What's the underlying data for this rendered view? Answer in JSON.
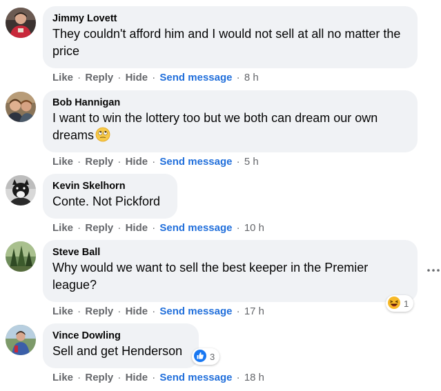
{
  "comments": [
    {
      "author": "Jimmy Lovett",
      "text": "They couldn't afford him and I would not sell at all no matter the price",
      "actions": {
        "like": "Like",
        "reply": "Reply",
        "hide": "Hide",
        "send": "Send message"
      },
      "time": "8 h",
      "avatar_icon": "person-red-shirt"
    },
    {
      "author": "Bob Hannigan",
      "text": "I want to win the lottery too but we both can dream our own dreams",
      "emoji": "face-with-rolling-eyes",
      "actions": {
        "like": "Like",
        "reply": "Reply",
        "hide": "Hide",
        "send": "Send message"
      },
      "time": "5 h",
      "avatar_icon": "two-people-selfie"
    },
    {
      "author": "Kevin Skelhorn",
      "text": "Conte. Not Pickford",
      "actions": {
        "like": "Like",
        "reply": "Reply",
        "hide": "Hide",
        "send": "Send message"
      },
      "time": "10 h",
      "avatar_icon": "black-white-dog"
    },
    {
      "author": "Steve Ball",
      "text": "Why would we want to sell the best keeper in the Premier league?",
      "actions": {
        "like": "Like",
        "reply": "Reply",
        "hide": "Hide",
        "send": "Send message"
      },
      "time": "17 h",
      "avatar_icon": "trees-landscape",
      "reaction": {
        "icon": "haha-reaction",
        "count": "1"
      }
    },
    {
      "author": "Vince Dowling",
      "text": "Sell and get Henderson",
      "actions": {
        "like": "Like",
        "reply": "Reply",
        "hide": "Hide",
        "send": "Send message"
      },
      "time": "18 h",
      "avatar_icon": "person-outdoors",
      "reaction": {
        "icon": "like-reaction",
        "count": "3"
      }
    }
  ],
  "more_options_icon": "ellipsis-icon",
  "colors": {
    "bubble": "#f0f2f5",
    "meta_text": "#65676b",
    "send_link": "#216fdb",
    "like_blue": "#1877f2",
    "haha_yellow": "#f7b928"
  }
}
